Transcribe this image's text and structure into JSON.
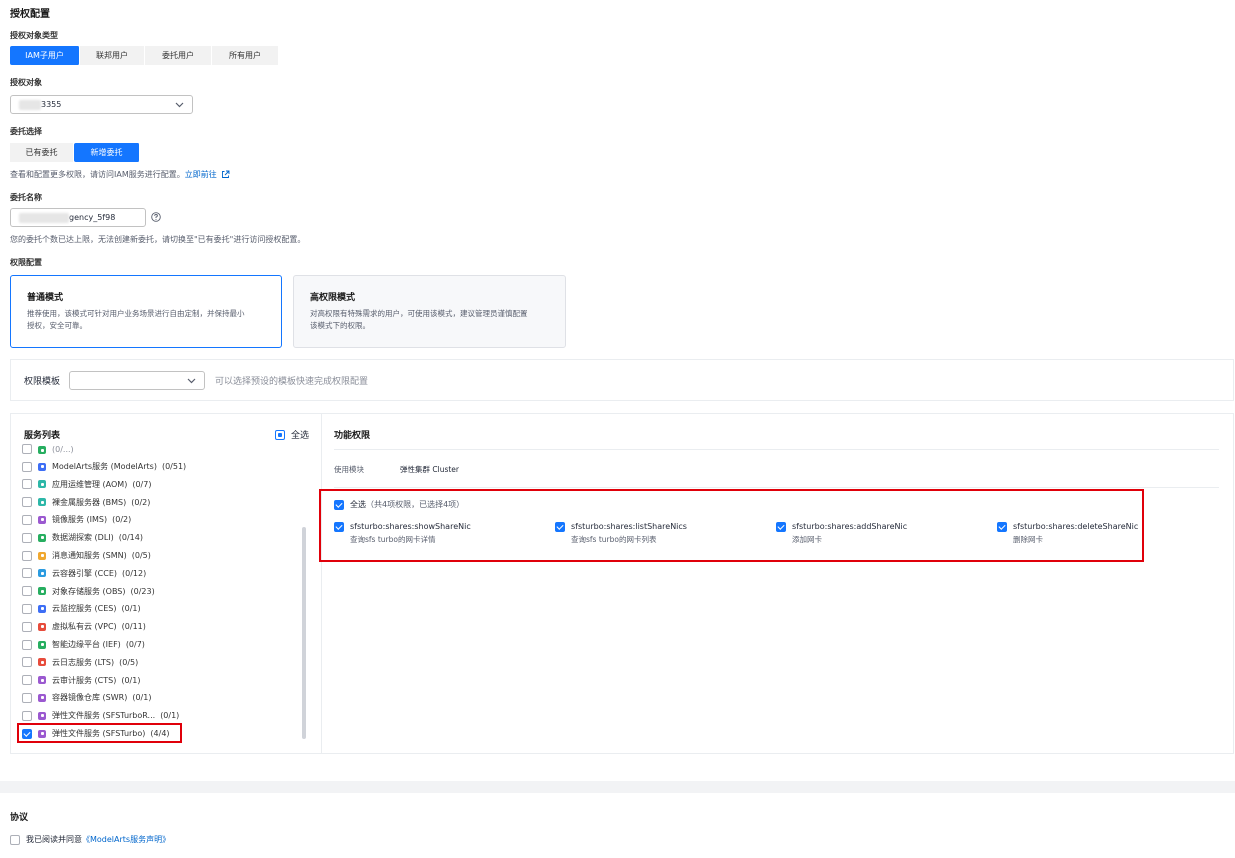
{
  "section_title": "授权配置",
  "target_type": {
    "label": "授权对象类型",
    "options": [
      "IAM子用户",
      "联邦用户",
      "委托用户",
      "所有用户"
    ],
    "selected": 0
  },
  "target": {
    "label": "授权对象",
    "value": "3355"
  },
  "agency_choice": {
    "label": "委托选择",
    "options": [
      "已有委托",
      "新增委托"
    ],
    "selected": 1,
    "hint": "查看和配置更多权限，请访问IAM服务进行配置。",
    "hint_link": "立即前往"
  },
  "agency_name": {
    "label": "委托名称",
    "value": "gency_5f98",
    "hint": "您的委托个数已达上限，无法创建新委托，请切换至\"已有委托\"进行访问授权配置。"
  },
  "permission_config": {
    "label": "权限配置",
    "modes": [
      {
        "title": "普通模式",
        "desc1": "推荐使用，该模式可针对用户业务场景进行自由定制，并保持最小",
        "desc2": "授权，安全可靠。"
      },
      {
        "title": "高权限模式",
        "desc1": "对高权限有特殊需求的用户，可使用该模式，建议管理员谨慎配置",
        "desc2": "该模式下的权限。"
      }
    ]
  },
  "template": {
    "label": "权限模板",
    "value": "",
    "hint": "可以选择预设的模板快速完成权限配置"
  },
  "service_list": {
    "title": "服务列表",
    "select_all": "全选",
    "partial_row": "(0/...)",
    "items": [
      {
        "label": "ModelArts服务 (ModelArts)",
        "count": "(0/51)",
        "color": "#3d6ef5",
        "checked": false
      },
      {
        "label": "应用运维管理 (AOM)",
        "count": "(0/7)",
        "color": "#2db7a8",
        "checked": false
      },
      {
        "label": "裸金属服务器 (BMS)",
        "count": "(0/2)",
        "color": "#2db7a8",
        "checked": false
      },
      {
        "label": "镜像服务 (IMS)",
        "count": "(0/2)",
        "color": "#9b59d0",
        "checked": false
      },
      {
        "label": "数据湖探索 (DLI)",
        "count": "(0/14)",
        "color": "#27ae60",
        "checked": false
      },
      {
        "label": "消息通知服务 (SMN)",
        "count": "(0/5)",
        "color": "#f0a830",
        "checked": false
      },
      {
        "label": "云容器引擎 (CCE)",
        "count": "(0/12)",
        "color": "#2b9be0",
        "checked": false
      },
      {
        "label": "对象存储服务 (OBS)",
        "count": "(0/23)",
        "color": "#27ae60",
        "checked": false
      },
      {
        "label": "云监控服务 (CES)",
        "count": "(0/1)",
        "color": "#3d6ef5",
        "checked": false
      },
      {
        "label": "虚拟私有云 (VPC)",
        "count": "(0/11)",
        "color": "#e74c3c",
        "checked": false
      },
      {
        "label": "智能边缘平台 (IEF)",
        "count": "(0/7)",
        "color": "#27ae60",
        "checked": false
      },
      {
        "label": "云日志服务 (LTS)",
        "count": "(0/5)",
        "color": "#e74c3c",
        "checked": false
      },
      {
        "label": "云审计服务 (CTS)",
        "count": "(0/1)",
        "color": "#9b59d0",
        "checked": false
      },
      {
        "label": "容器镜像仓库 (SWR)",
        "count": "(0/1)",
        "color": "#9b59d0",
        "checked": false
      },
      {
        "label": "弹性文件服务 (SFSTurboR...",
        "count": "(0/1)",
        "color": "#9b59d0",
        "checked": false
      },
      {
        "label": "弹性文件服务 (SFSTurbo)",
        "count": "(4/4)",
        "color": "#9b59d0",
        "checked": true
      }
    ]
  },
  "function_permissions": {
    "title": "功能权限",
    "module_label": "使用模块",
    "module_value": "弹性集群 Cluster",
    "select_all": "全选",
    "select_all_note": "（共4项权限，已选择4项）",
    "items": [
      {
        "name": "sfsturbo:shares:showShareNic",
        "desc": "查询sfs turbo的网卡详情"
      },
      {
        "name": "sfsturbo:shares:listShareNics",
        "desc": "查询sfs turbo的网卡列表"
      },
      {
        "name": "sfsturbo:shares:addShareNic",
        "desc": "添加网卡"
      },
      {
        "name": "sfsturbo:shares:deleteShareNic",
        "desc": "删除网卡"
      }
    ]
  },
  "agreement": {
    "title": "协议",
    "text": "我已阅读并同意",
    "link": "《ModelArts服务声明》"
  }
}
